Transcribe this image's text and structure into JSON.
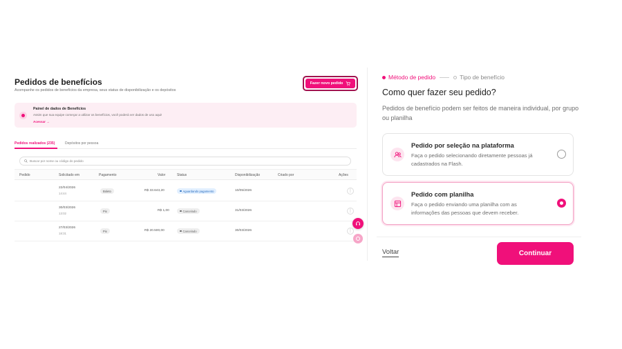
{
  "colors": {
    "accent": "#f0107a",
    "accent_light": "#fde4ef",
    "status_waiting": "#e1efff"
  },
  "left": {
    "title": "Pedidos de benefícios",
    "subtitle": "Acompanhe os pedidos de benefícios da empresa, seus status de disponibilização e os depósitos",
    "new_order_button": "Fazer novo pedido",
    "info_box": {
      "title": "Painel de dados de Benefícios",
      "text": "Assim que sua equipe começar a utilizar os benefícios, você poderá ver dados de uso aqui!",
      "link": "Acessar"
    },
    "tabs": [
      "Pedidos realizados (235)",
      "Depósitos por pessoa"
    ],
    "search_placeholder": "Buscar por nome ou código do pedido",
    "columns": [
      "Pedido",
      "Solicitado em",
      "Pagamento",
      "Valor",
      "Status",
      "Disponibilização",
      "Criado por",
      "Ações"
    ],
    "rows": [
      {
        "date": "22/04/2026",
        "time": "14:44",
        "payment": "Boleto",
        "value": "R$ 33.643,20",
        "status": "Aguardando pagamento",
        "status_kind": "wait",
        "availability": "10/05/2026",
        "creator": ""
      },
      {
        "date": "30/03/2026",
        "time": "13:02",
        "payment": "Pix",
        "value": "R$ 1,00",
        "status": "Cancelado",
        "status_kind": "cancel",
        "availability": "31/03/2026",
        "creator": ""
      },
      {
        "date": "27/03/2026",
        "time": "18:31",
        "payment": "Pix",
        "value": "R$ 20.500,00",
        "status": "Cancelado",
        "status_kind": "cancel",
        "availability": "30/03/2026",
        "creator": ""
      }
    ],
    "row_action_icon": "more-vertical-icon"
  },
  "right": {
    "steps": [
      {
        "label": "Método de pedido",
        "active": true
      },
      {
        "label": "Tipo de benefício",
        "active": false
      }
    ],
    "title": "Como quer fazer seu pedido?",
    "description": "Pedidos de benefício podem ser feitos de maneira individual, por grupo ou planilha",
    "options": [
      {
        "title": "Pedido por seleção na plataforma",
        "text": "Faça o pedido selecionando diretamente pessoas já cadastrados na Flash.",
        "icon": "users-icon",
        "selected": false
      },
      {
        "title": "Pedido com planilha",
        "text": "Faça o pedido enviando uma planilha com as informações das pessoas que devem receber.",
        "icon": "spreadsheet-icon",
        "selected": true
      }
    ],
    "back_label": "Voltar",
    "continue_label": "Continuar"
  }
}
